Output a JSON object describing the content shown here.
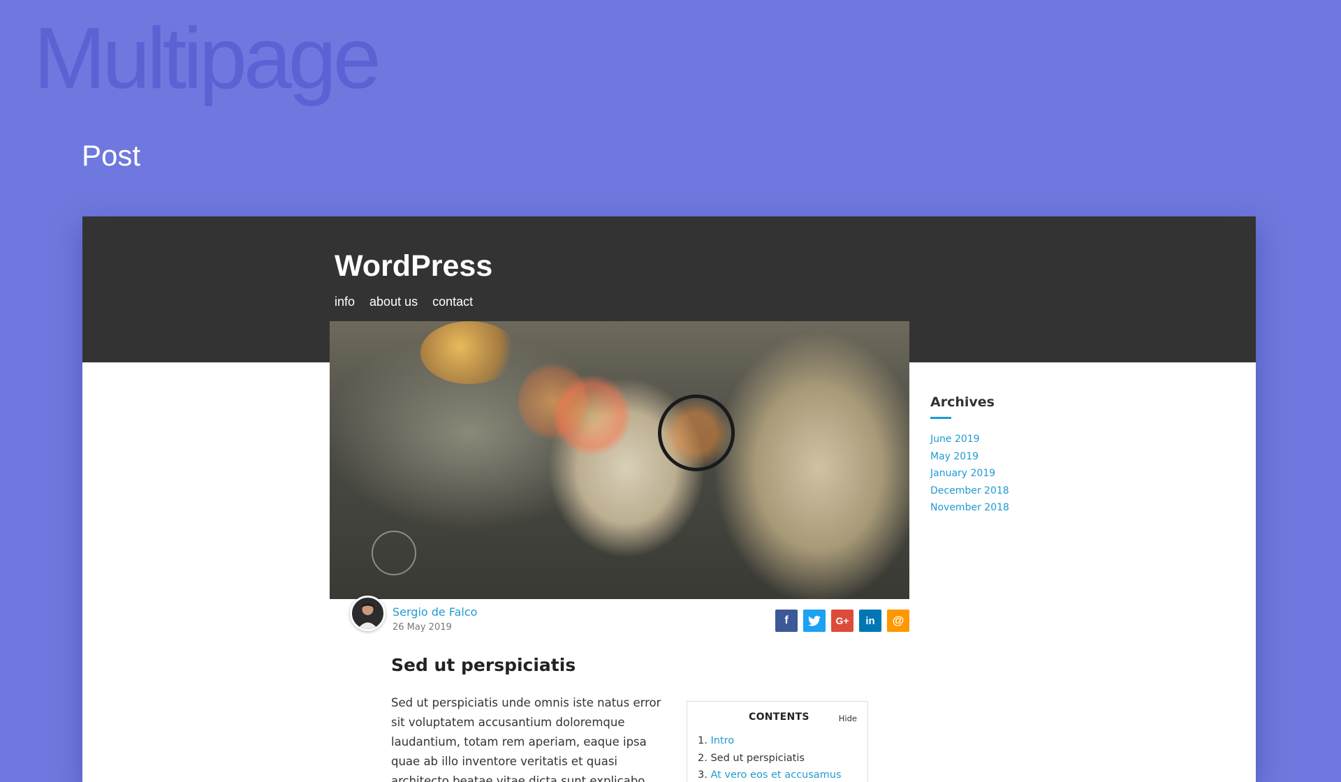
{
  "page": {
    "brand_word": "Multipage",
    "section_title": "Post"
  },
  "site": {
    "title": "WordPress",
    "nav": [
      {
        "label": "info"
      },
      {
        "label": "about us"
      },
      {
        "label": "contact"
      }
    ]
  },
  "post": {
    "hero_icon": "photo-image",
    "author": {
      "name": "Sergio de Falco",
      "avatar_icon": "avatar-icon"
    },
    "date": "26 May 2019",
    "share": [
      {
        "name": "facebook-icon",
        "glyph": "f",
        "color": "#3b5998"
      },
      {
        "name": "twitter-icon",
        "glyph": "t",
        "color": "#1da1f2"
      },
      {
        "name": "google-plus-icon",
        "glyph": "G+",
        "color": "#dd4b39"
      },
      {
        "name": "linkedin-icon",
        "glyph": "in",
        "color": "#0077b5"
      },
      {
        "name": "email-icon",
        "glyph": "@",
        "color": "#ff9800"
      }
    ],
    "title": "Sed ut perspiciatis",
    "body": "Sed ut perspiciatis unde omnis iste natus error sit voluptatem accusantium doloremque laudantium, totam rem aperiam, eaque ipsa quae ab illo inventore veritatis et quasi architecto beatae vitae dicta sunt explicabo. Nemo enim"
  },
  "toc": {
    "heading": "CONTENTS",
    "hide_label": "Hide",
    "items": [
      {
        "num": "1.",
        "label": "Intro",
        "link": true
      },
      {
        "num": "2.",
        "label": "Sed ut perspiciatis",
        "link": false
      },
      {
        "num": "3.",
        "label": "At vero eos et accusamus",
        "link": true
      }
    ]
  },
  "sidebar": {
    "heading": "Archives",
    "items": [
      {
        "label": "June 2019"
      },
      {
        "label": "May 2019"
      },
      {
        "label": "January 2019"
      },
      {
        "label": "December 2018"
      },
      {
        "label": "November 2018"
      }
    ]
  },
  "colors": {
    "background": "#6f78de",
    "header": "#333333",
    "accent": "#1f9bd1"
  }
}
